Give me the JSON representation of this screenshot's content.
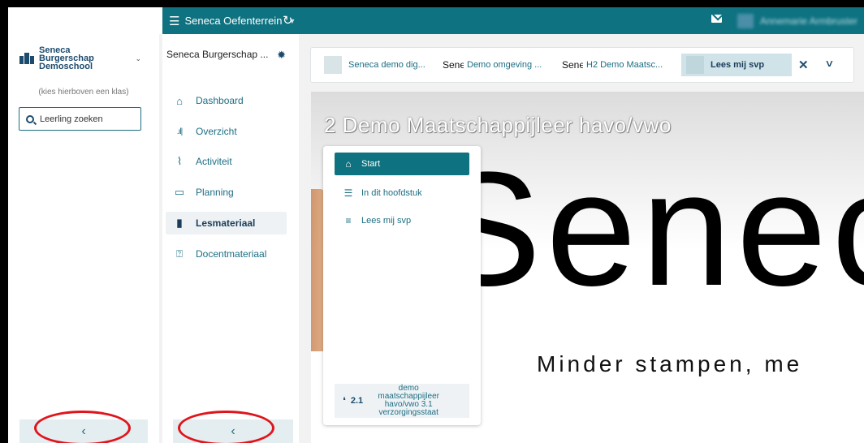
{
  "topbar": {
    "environment_label": "Seneca Oefenterrein",
    "user_name": "Annemarie Armbruster"
  },
  "school": {
    "name_line1": "Seneca",
    "name_line2": "Burgerschap",
    "name_line3": "Demoschool",
    "class_hint": "(kies hierboven een klas)",
    "search_placeholder": "Leerling zoeken"
  },
  "course": {
    "name": "Seneca Burgerschap ...",
    "nav": [
      {
        "label": "Dashboard",
        "icon": "home-icon"
      },
      {
        "label": "Overzicht",
        "icon": "bar-chart-icon"
      },
      {
        "label": "Activiteit",
        "icon": "line-chart-icon"
      },
      {
        "label": "Planning",
        "icon": "calendar-icon"
      },
      {
        "label": "Lesmateriaal",
        "icon": "document-icon",
        "active": true
      },
      {
        "label": "Docentmateriaal",
        "icon": "teacher-icon"
      }
    ]
  },
  "tabs": [
    {
      "label": "Seneca demo dig...",
      "thumb": ""
    },
    {
      "label": "Demo omgeving ...",
      "thumb": "Sene"
    },
    {
      "label": "H2 Demo Maatsc...",
      "thumb": "Sene"
    },
    {
      "label": "Lees mij svp",
      "thumb": "",
      "active": true
    }
  ],
  "content": {
    "title": "2 Demo Maatschappijleer havo/vwo",
    "hero_word": "Senec",
    "hero_slogan": "Minder stampen, me"
  },
  "chapter_menu": {
    "items": [
      {
        "label": "Start",
        "icon": "home-icon",
        "active": true
      },
      {
        "label": "In dit hoofdstuk",
        "icon": "list-icon"
      },
      {
        "label": "Lees mij svp",
        "icon": "text-lines-icon"
      }
    ],
    "next_number": "2.1",
    "next_title": "demo maatschappijleer havo/vwo 3.1 verzorgingsstaat"
  },
  "colors": {
    "teal": "#0e7280",
    "annotation_red": "#e0141b"
  }
}
